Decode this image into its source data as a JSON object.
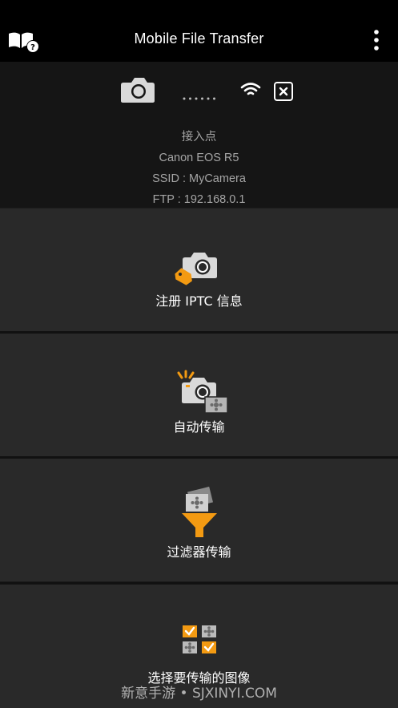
{
  "header": {
    "title": "Mobile File Transfer",
    "help_icon": "book-help-icon",
    "menu_icon": "more-vertical-icon"
  },
  "connection": {
    "camera_icon": "camera-icon",
    "link_icon": "dotted-link-icon",
    "wifi_icon": "wifi-icon",
    "close_icon": "close-icon",
    "access_point_label": "接入点",
    "camera_model": "Canon EOS R5",
    "ssid": "SSID : MyCamera",
    "ftp": "FTP : 192.168.0.1"
  },
  "menu": {
    "items": [
      {
        "label": "注册 IPTC 信息",
        "icon": "camera-tag-icon"
      },
      {
        "label": "自动传输",
        "icon": "auto-transfer-icon"
      },
      {
        "label": "过滤器传输",
        "icon": "filter-transfer-icon"
      },
      {
        "label": "选择要传输的图像",
        "icon": "select-images-icon"
      }
    ]
  },
  "watermark": "新意手游 • SJXINYI.COM",
  "colors": {
    "accent": "#f39a12",
    "background": "#292929",
    "header": "#000000"
  }
}
